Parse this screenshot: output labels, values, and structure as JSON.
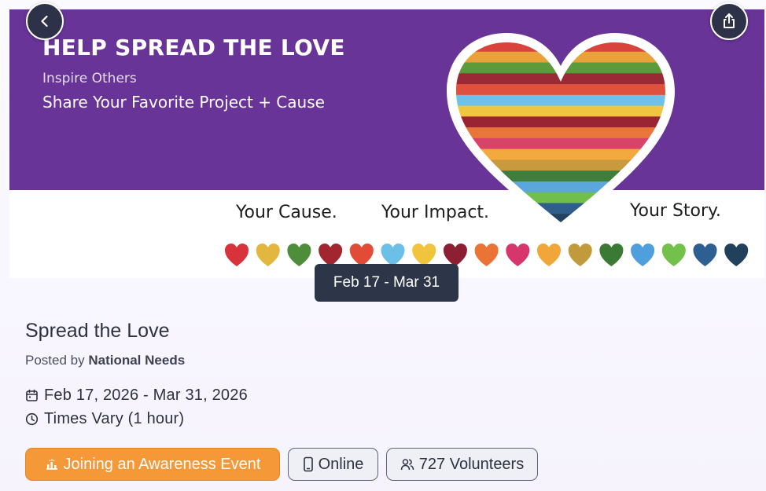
{
  "banner": {
    "headline": "HELP SPREAD THE LOVE",
    "subhead1": "Inspire Others",
    "subhead2": "Share Your Favorite Project + Cause",
    "taglines": [
      "Your Cause.",
      "Your Impact.",
      "Your Story."
    ],
    "heart_stripe_colors": [
      "#d8443b",
      "#e9a13a",
      "#5b9b3c",
      "#9a2a35",
      "#e0513d",
      "#6ec2e8",
      "#f0c540",
      "#9b2433",
      "#e8763a",
      "#d8436a",
      "#f2a93e",
      "#c99a3d",
      "#3f7d3b",
      "#5aa6dd",
      "#6fbf4a",
      "#2f5d8c",
      "#23425f"
    ],
    "small_heart_colors": [
      "#d8333b",
      "#e3b63f",
      "#4e8e3a",
      "#a2262f",
      "#e24b35",
      "#6cbfe6",
      "#f1c43d",
      "#8c1f32",
      "#ea7435",
      "#d7366c",
      "#f1a63a",
      "#c19a3b",
      "#3b7a34",
      "#4f9fdc",
      "#73c04a",
      "#2d5f91",
      "#21405c"
    ]
  },
  "nav": {
    "back_icon": "chevron-left-icon",
    "share_icon": "share-icon"
  },
  "date_pill": "Feb 17 - Mar 31",
  "event": {
    "title": "Spread the Love",
    "posted_prefix": "Posted by",
    "organization": "National Needs",
    "date_range": "Feb 17, 2026 - Mar 31, 2026",
    "time": "Times Vary (1 hour)"
  },
  "tags": {
    "category": "Joining an Awareness Event",
    "category_color": "#f49838",
    "location": "Online",
    "volunteers": "727 Volunteers"
  }
}
